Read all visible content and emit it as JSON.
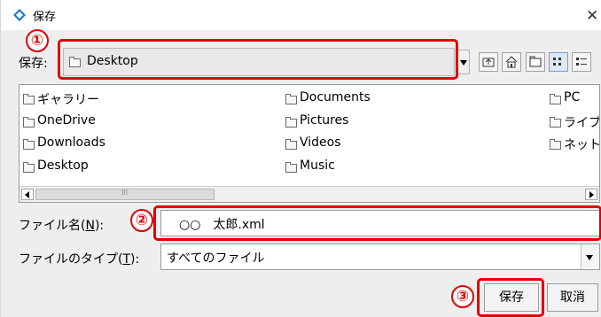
{
  "window": {
    "title": "保存",
    "close_glyph": "✕"
  },
  "save_in": {
    "label": "保存:",
    "value": "Desktop"
  },
  "toolbar": [
    "up-folder-icon",
    "home-icon",
    "new-folder-icon",
    "list-view-icon",
    "details-view-icon"
  ],
  "files": {
    "column1": [
      "ギャラリー",
      "OneDrive",
      "Downloads",
      "Desktop"
    ],
    "column2": [
      "Documents",
      "Pictures",
      "Videos",
      "Music"
    ],
    "column3": [
      "PC",
      "ライブ",
      "ネット"
    ]
  },
  "file_name": {
    "label_prefix": "ファイル名(",
    "mnemonic": "N",
    "label_suffix": "):",
    "value": "○○　太郎.xml"
  },
  "file_type": {
    "label_prefix": "ファイルのタイプ(",
    "mnemonic": "T",
    "label_suffix": "):",
    "value": "すべてのファイル"
  },
  "buttons": {
    "save": "保存",
    "cancel": "取消"
  },
  "annotations": {
    "m1": "①",
    "m2": "②",
    "m3": "③"
  },
  "colors": {
    "highlight": "#e00000",
    "selected_view": "#dde8f5"
  }
}
